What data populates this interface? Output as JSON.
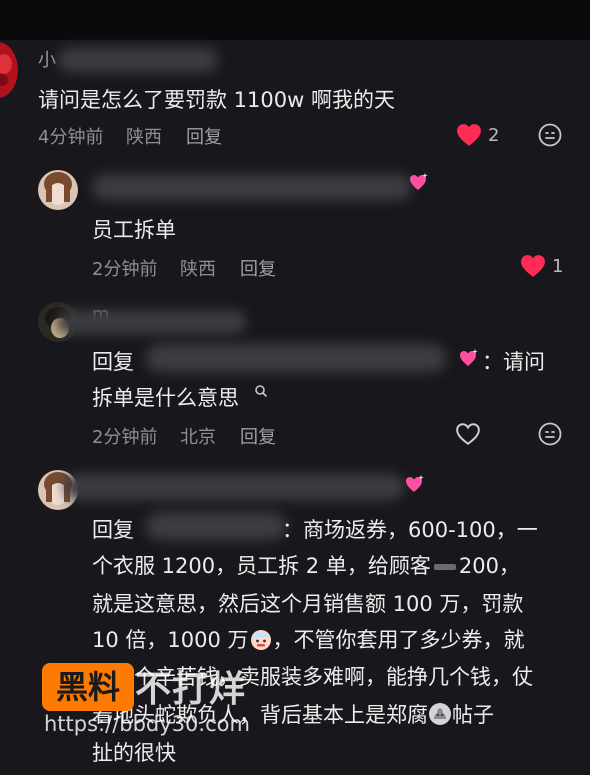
{
  "comment1": {
    "name": "小",
    "text": "请问是怎么了要罚款 1100w 啊我的天",
    "time": "4分钟前",
    "location": "陕西",
    "reply_label": "回复",
    "like_count": "2"
  },
  "reply1": {
    "text": "员工拆单",
    "time": "2分钟前",
    "location": "陕西",
    "reply_label": "回复",
    "like_count": "1"
  },
  "reply2": {
    "name": "m",
    "prefix": "回复",
    "line1_tail": "：请问",
    "line2": "拆单是什么意思",
    "time": "2分钟前",
    "location": "北京",
    "reply_label": "回复"
  },
  "reply3": {
    "prefix": "回复",
    "line1_tail": "：商场返券，600-100，一",
    "line2a": "个衣服 1200，员工拆 2 单，给顾客",
    "line2b": "200，",
    "line3": "就是这意思，然后这个月销售额 100 万，罚款",
    "line4a": "10 倍，1000 万",
    "line4b": "，不管你套用了多少券，就",
    "line5": "是赚个辛苦钱，卖服装多难啊，能挣几个钱，仗",
    "line6a": "着地头蛇欺负人，背后基本上是郑腐",
    "line6b": "帖子",
    "line7": "扯的很快"
  },
  "watermark": {
    "logo": "黑料",
    "text": "不打烊",
    "url": "https://bbdy30.com"
  }
}
